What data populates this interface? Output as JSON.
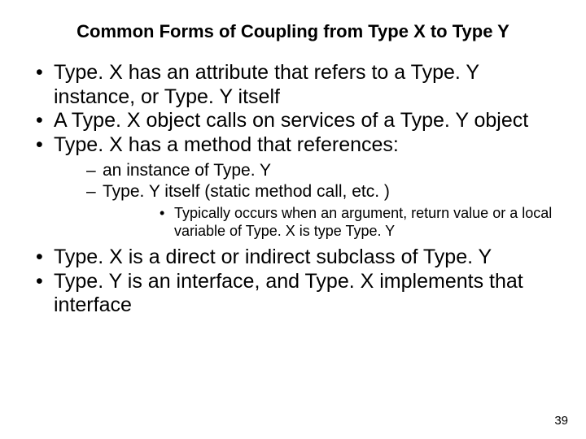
{
  "slide": {
    "title": "Common Forms of Coupling from Type X to Type Y",
    "bullets": {
      "b1": "Type. X has an attribute that refers to a Type. Y instance, or Type. Y itself",
      "b2": "A Type. X object calls on services of a Type. Y object",
      "b3": "Type. X has a method that references:",
      "b3_sub1": "an instance of Type. Y",
      "b3_sub2": "Type. Y itself (static method call, etc. )",
      "b3_sub2_sub1": "Typically occurs when an argument, return value or a local variable of Type. X is type Type. Y",
      "b4": "Type. X is a direct or indirect subclass of Type. Y",
      "b5": "Type. Y is an interface, and Type. X implements that interface"
    },
    "page_number": "39"
  }
}
